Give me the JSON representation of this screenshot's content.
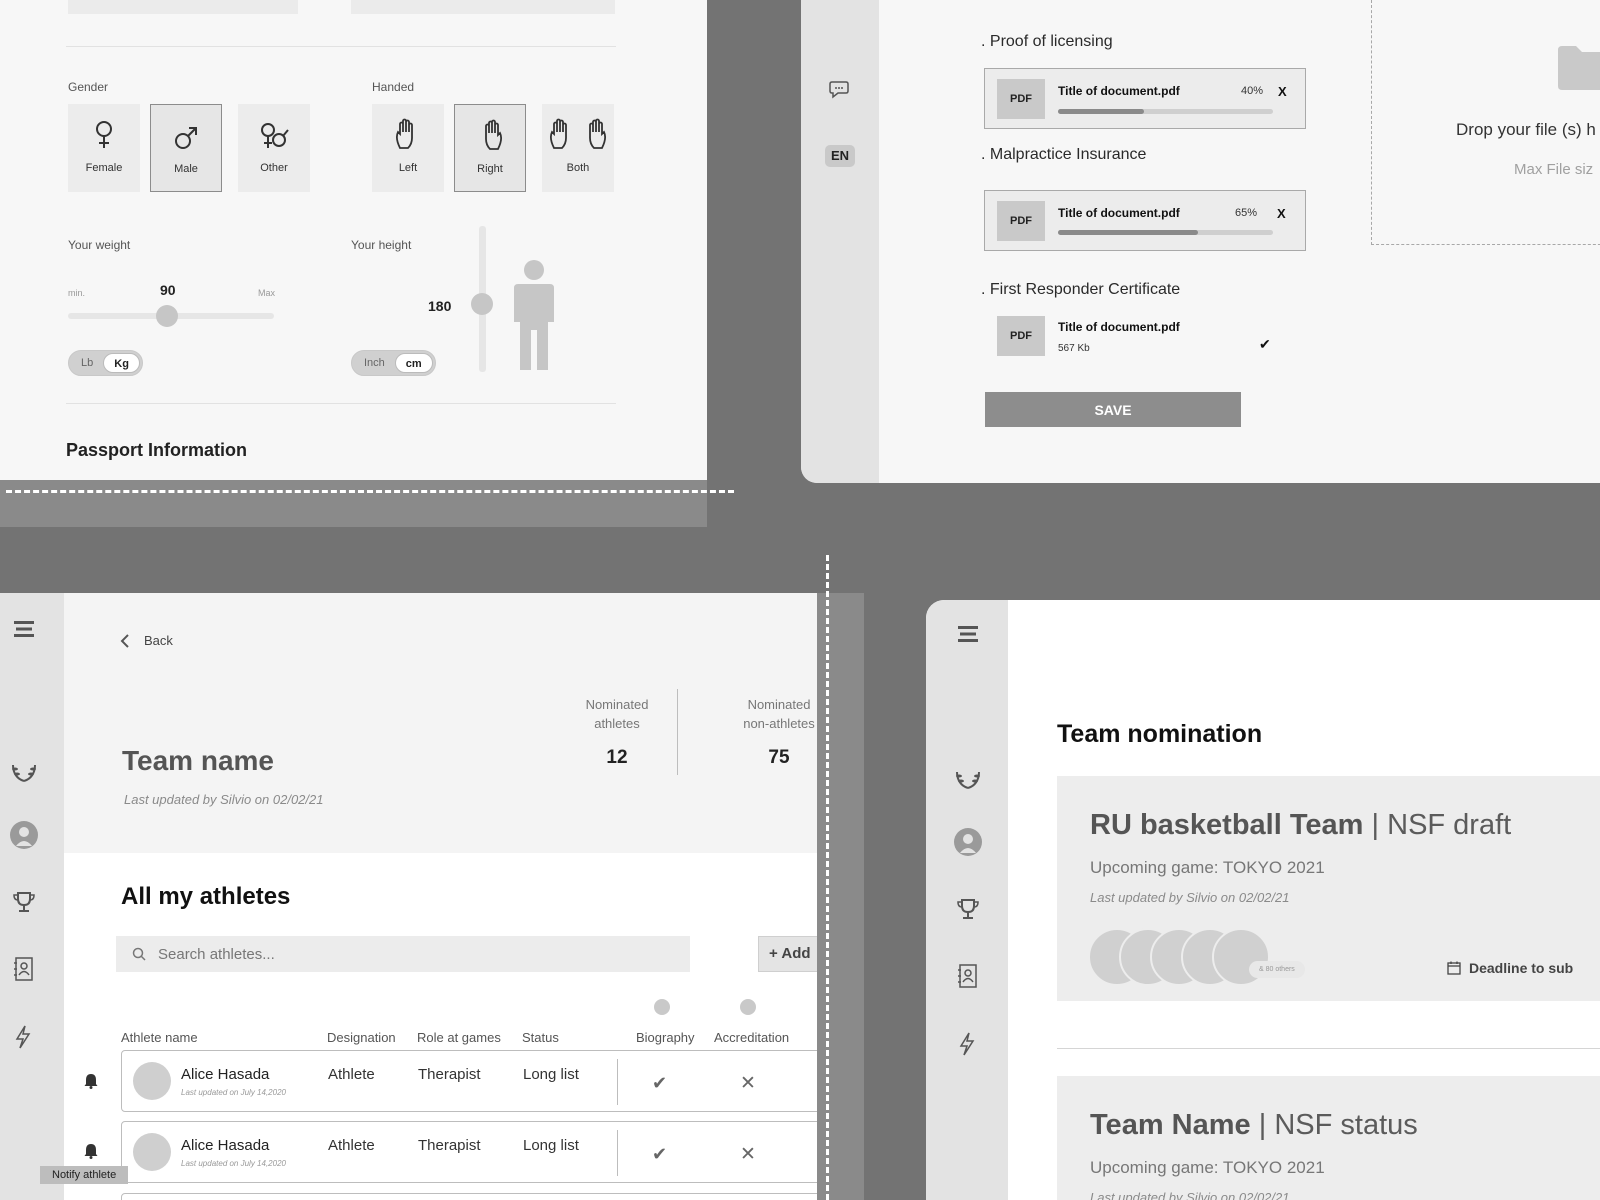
{
  "colors": {
    "background": "#737373",
    "panel": "#f7f7f7",
    "sidebar": "#e3e3e3",
    "accent_gray": "#8d8d8d"
  },
  "profile": {
    "gender": {
      "label": "Gender",
      "options": [
        "Female",
        "Male",
        "Other"
      ],
      "selected": "Male"
    },
    "handed": {
      "label": "Handed",
      "options": [
        "Left",
        "Right",
        "Both"
      ],
      "selected": "Right"
    },
    "weight": {
      "label": "Your weight",
      "min_label": "min.",
      "max_label": "Max",
      "value": "90",
      "slider_fraction": 0.48,
      "units": [
        "Lb",
        "Kg"
      ],
      "selected_unit": "Kg"
    },
    "height": {
      "label": "Your height",
      "value": "180",
      "slider_fraction": 0.54,
      "units": [
        "Inch",
        "cm"
      ],
      "selected_unit": "cm"
    },
    "passport_title": "Passport Information"
  },
  "documents": {
    "language": "EN",
    "sections": [
      {
        "title": "Proof of licensing",
        "file": "Title of document.pdf",
        "type": "PDF",
        "progress_text": "40%",
        "progress": 0.4,
        "remove": "X"
      },
      {
        "title": "Malpractice Insurance",
        "file": "Title of document.pdf",
        "type": "PDF",
        "progress_text": "65%",
        "progress": 0.65,
        "remove": "X"
      },
      {
        "title": "First Responder Certificate",
        "file": "Title of document.pdf",
        "type": "PDF",
        "size": "567 Kb",
        "done": "✔"
      }
    ],
    "save_label": "SAVE",
    "dropzone_text": "Drop your file (s) h",
    "dropzone_sub": "Max File siz"
  },
  "team": {
    "back_label": "Back",
    "name": "Team name",
    "updated": "Last updated by Silvio on 02/02/21",
    "stats": [
      {
        "label_line1": "Nominated",
        "label_line2": "athletes",
        "value": "12"
      },
      {
        "label_line1": "Nominated",
        "label_line2": "non-athletes",
        "value": "75"
      }
    ],
    "athletes_title": "All my athletes",
    "search_placeholder": "Search athletes...",
    "add_label": "+ Add",
    "columns": [
      "Athlete name",
      "Designation",
      "Role at games",
      "Status",
      "Biography",
      "Accreditation"
    ],
    "rows": [
      {
        "name": "Alice Hasada",
        "updated": "Last updated on July 14,2020",
        "designation": "Athlete",
        "role": "Therapist",
        "status": "Long list",
        "biography": "✔",
        "accreditation": "✕"
      },
      {
        "name": "Alice Hasada",
        "updated": "Last updated on July 14,2020",
        "designation": "Athlete",
        "role": "Therapist",
        "status": "Long list",
        "biography": "✔",
        "accreditation": "✕"
      }
    ],
    "tooltip": "Notify athlete"
  },
  "nomination": {
    "title": "Team nomination",
    "cards": [
      {
        "team": "RU basketball Team",
        "sep": "|",
        "status": "NSF draft",
        "upcoming": "Upcoming game: TOKYO 2021",
        "updated": "Last updated by Silvio on 02/02/21",
        "others": "& 80 others",
        "deadline": "Deadline to sub"
      },
      {
        "team": "Team Name",
        "sep": "|",
        "status": "NSF status",
        "upcoming": "Upcoming game: TOKYO 2021",
        "updated": "Last updated by Silvio on 02/02/21"
      }
    ]
  }
}
